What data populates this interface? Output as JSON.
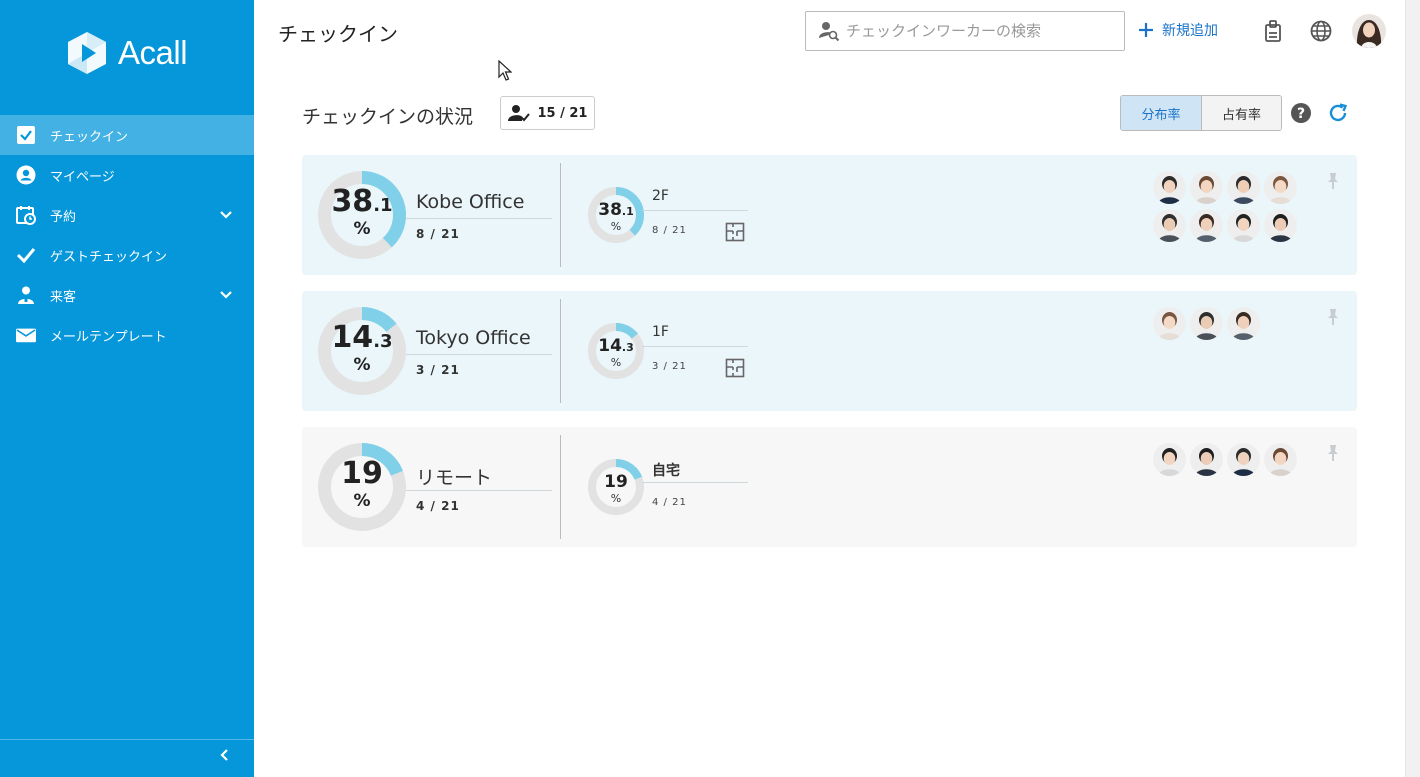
{
  "app": {
    "logo_text": "Acall"
  },
  "sidebar": {
    "items": [
      {
        "label": "チェックイン",
        "icon": "checkbox-icon",
        "active": true
      },
      {
        "label": "マイページ",
        "icon": "user-circle-icon"
      },
      {
        "label": "予約",
        "icon": "calendar-clock-icon",
        "expandable": true
      },
      {
        "label": "ゲストチェックイン",
        "icon": "check-icon"
      },
      {
        "label": "来客",
        "icon": "visitor-icon",
        "expandable": true
      },
      {
        "label": "メールテンプレート",
        "icon": "mail-icon"
      }
    ]
  },
  "header": {
    "title": "チェックイン",
    "search_placeholder": "チェックインワーカーの検索",
    "add_label": "新規追加"
  },
  "status": {
    "title": "チェックインの状況",
    "count": "15 / 21",
    "toggle": [
      "分布率",
      "占有率"
    ],
    "toggle_active": 0
  },
  "colors": {
    "primary": "#0597da",
    "ring": "#7fd0e8",
    "ring_bg": "#e2e2e2"
  },
  "locations": [
    {
      "name": "Kobe Office",
      "pct_int": "38",
      "pct_dec": ".1",
      "pct": 38.1,
      "count": "8 / 21",
      "floor": {
        "name": "2F",
        "pct_int": "38",
        "pct_dec": ".1",
        "count": "8 / 21",
        "map": true
      },
      "avatars": 8
    },
    {
      "name": "Tokyo Office",
      "pct_int": "14",
      "pct_dec": ".3",
      "pct": 14.3,
      "count": "3 / 21",
      "floor": {
        "name": "1F",
        "pct_int": "14",
        "pct_dec": ".3",
        "count": "3 / 21",
        "map": true
      },
      "avatars": 3
    },
    {
      "name": "リモート",
      "pct_int": "19",
      "pct_dec": "",
      "pct": 19,
      "count": "4 / 21",
      "floor": {
        "name": "自宅",
        "pct_int": "19",
        "pct_dec": "",
        "count": "4 / 21",
        "map": false
      },
      "avatars": 4
    }
  ],
  "pct_symbol": "%"
}
